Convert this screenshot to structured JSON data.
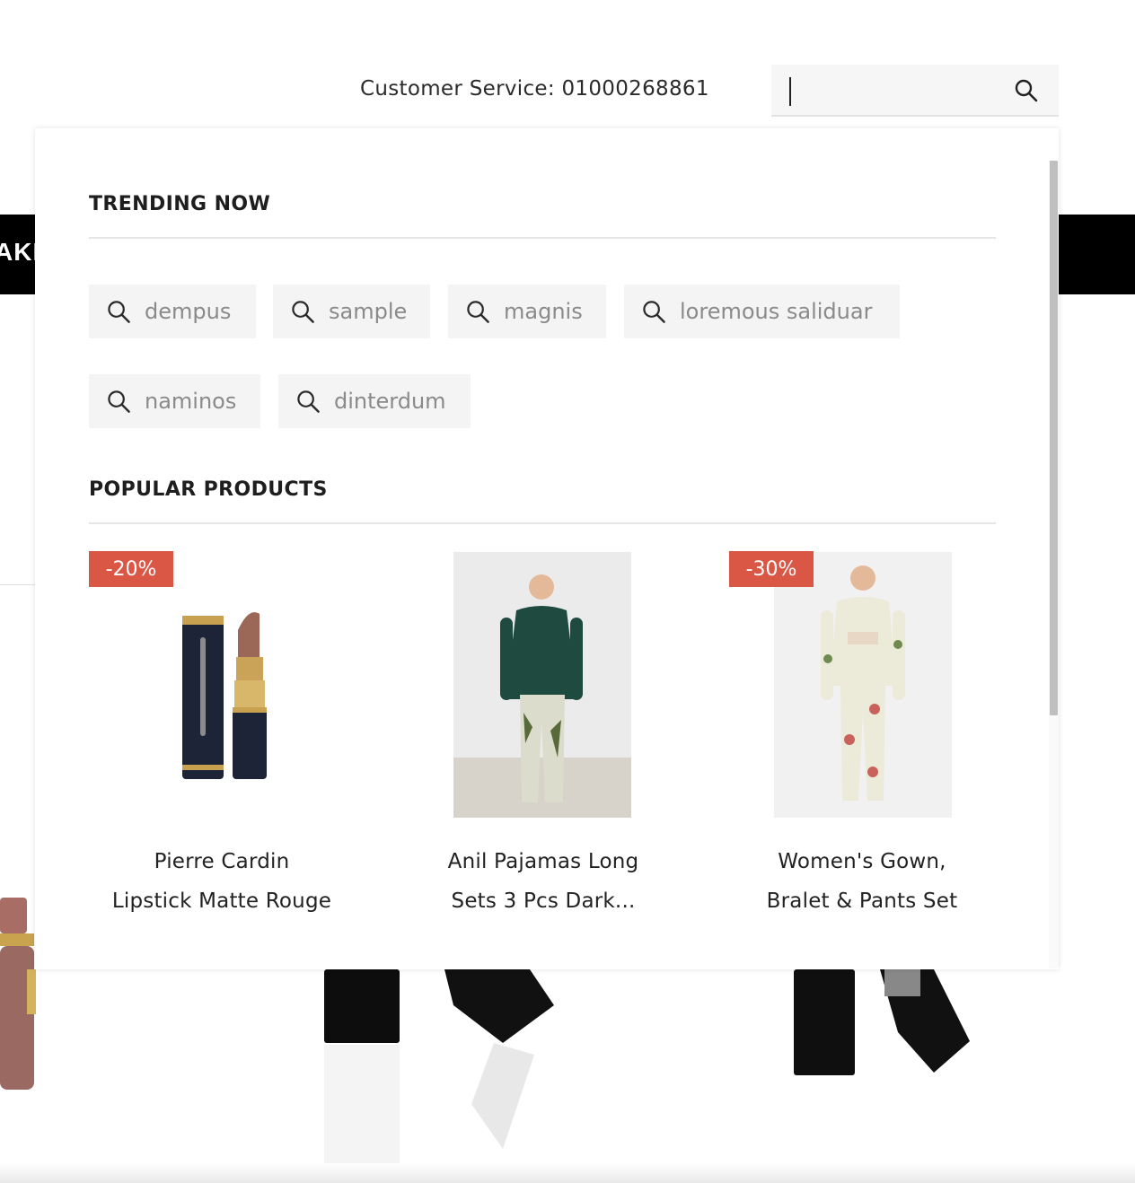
{
  "header": {
    "customer_service": "Customer Service: 01000268861",
    "search": {
      "value": "",
      "placeholder": "",
      "icon": "search-icon"
    }
  },
  "background": {
    "banner_text": "AKE"
  },
  "dropdown": {
    "trending_title": "TRENDING NOW",
    "trending": [
      {
        "label": "dempus"
      },
      {
        "label": "sample"
      },
      {
        "label": "magnis"
      },
      {
        "label": "loremous saliduar"
      },
      {
        "label": "naminos"
      },
      {
        "label": "dinterdum"
      }
    ],
    "popular_title": "POPULAR PRODUCTS",
    "products": [
      {
        "name_line1": "Pierre Cardin",
        "name_line2": "Lipstick Matte Rouge",
        "badge": "-20%"
      },
      {
        "name_line1": "Anil Pajamas Long",
        "name_line2": "Sets 3 Pcs Dark...",
        "badge": ""
      },
      {
        "name_line1": "Women's Gown,",
        "name_line2": "Bralet & Pants Set",
        "badge": "-30%"
      }
    ]
  },
  "colors": {
    "badge": "#db5745",
    "chip_bg": "#f4f4f4",
    "chip_text": "#8a8a8a",
    "banner": "#000000"
  }
}
